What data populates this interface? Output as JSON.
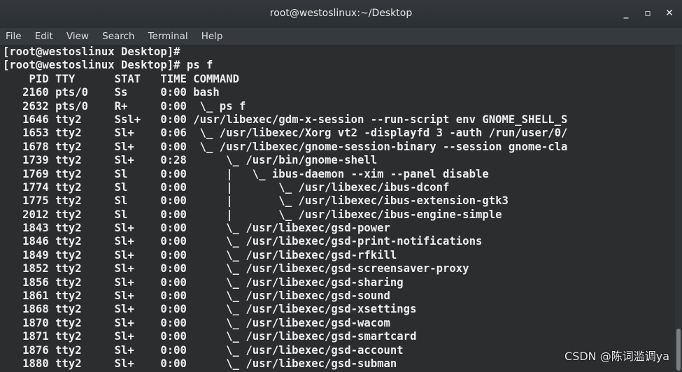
{
  "window": {
    "title": "root@westoslinux:~/Desktop",
    "minimize": "_",
    "maximize": "▫",
    "close": "✕"
  },
  "menu": [
    "File",
    "Edit",
    "View",
    "Search",
    "Terminal",
    "Help"
  ],
  "terminal": {
    "lines": [
      "[root@westoslinux Desktop]#",
      "[root@westoslinux Desktop]# ps f",
      "    PID TTY      STAT   TIME COMMAND",
      "   2160 pts/0    Ss     0:00 bash",
      "   2632 pts/0    R+     0:00  \\_ ps f",
      "   1646 tty2     Ssl+   0:00 /usr/libexec/gdm-x-session --run-script env GNOME_SHELL_S",
      "   1653 tty2     Sl+    0:06  \\_ /usr/libexec/Xorg vt2 -displayfd 3 -auth /run/user/0/",
      "   1678 tty2     Sl+    0:00  \\_ /usr/libexec/gnome-session-binary --session gnome-cla",
      "   1739 tty2     Sl+    0:28      \\_ /usr/bin/gnome-shell",
      "   1769 tty2     Sl     0:00      |   \\_ ibus-daemon --xim --panel disable",
      "   1774 tty2     Sl     0:00      |       \\_ /usr/libexec/ibus-dconf",
      "   1775 tty2     Sl     0:00      |       \\_ /usr/libexec/ibus-extension-gtk3",
      "   2012 tty2     Sl     0:00      |       \\_ /usr/libexec/ibus-engine-simple",
      "   1843 tty2     Sl+    0:00      \\_ /usr/libexec/gsd-power",
      "   1846 tty2     Sl+    0:00      \\_ /usr/libexec/gsd-print-notifications",
      "   1849 tty2     Sl+    0:00      \\_ /usr/libexec/gsd-rfkill",
      "   1852 tty2     Sl+    0:00      \\_ /usr/libexec/gsd-screensaver-proxy",
      "   1856 tty2     Sl+    0:00      \\_ /usr/libexec/gsd-sharing",
      "   1861 tty2     Sl+    0:00      \\_ /usr/libexec/gsd-sound",
      "   1868 tty2     Sl+    0:00      \\_ /usr/libexec/gsd-xsettings",
      "   1870 tty2     Sl+    0:00      \\_ /usr/libexec/gsd-wacom",
      "   1871 tty2     Sl+    0:00      \\_ /usr/libexec/gsd-smartcard",
      "   1876 tty2     Sl+    0:00      \\_ /usr/libexec/gsd-account",
      "   1880 tty2     Sl+    0:00      \\_ /usr/libexec/gsd-subman"
    ]
  },
  "watermark": "CSDN @陈词滥调ya"
}
